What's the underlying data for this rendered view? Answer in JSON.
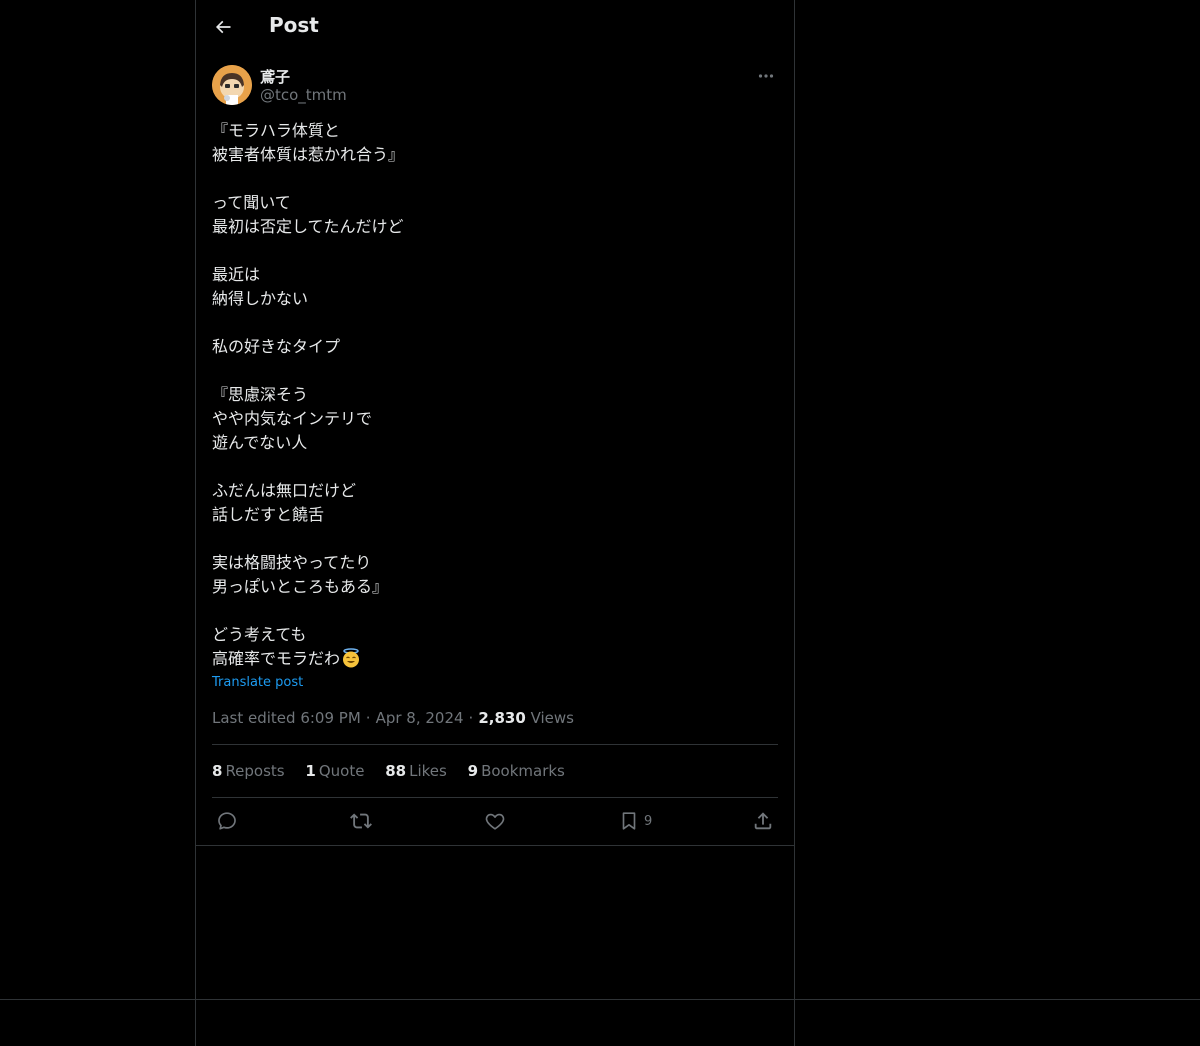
{
  "header": {
    "title": "Post"
  },
  "author": {
    "name": "鳶子",
    "handle": "@tco_tmtm"
  },
  "post": {
    "lines": [
      "『モラハラ体質と",
      "被害者体質は惹かれ合う』",
      "",
      "って聞いて",
      "最初は否定してたんだけど",
      "",
      "最近は",
      "納得しかない",
      "",
      "私の好きなタイプ",
      "",
      "『思慮深そう",
      "やや内気なインテリで",
      "遊んでない人",
      "",
      "ふだんは無口だけど",
      "話しだすと饒舌",
      "",
      "実は格闘技やってたり",
      "男っぽいところもある』",
      "",
      "どう考えても",
      "高確率でモラだわ"
    ],
    "emoji": "smiling-face-with-halo",
    "translate_label": "Translate post"
  },
  "meta": {
    "edited_label": "Last edited 6:09 PM",
    "date": "Apr 8, 2024",
    "separator": "·",
    "views_count": "2,830",
    "views_label": "Views"
  },
  "stats": {
    "reposts": {
      "count": "8",
      "label": "Reposts"
    },
    "quotes": {
      "count": "1",
      "label": "Quote"
    },
    "likes": {
      "count": "88",
      "label": "Likes"
    },
    "bookmarks": {
      "count": "9",
      "label": "Bookmarks"
    }
  },
  "actions": {
    "bookmark_count": "9"
  },
  "colors": {
    "background": "#000000",
    "text": "#e7e9ea",
    "secondary": "#71767b",
    "border": "#2f3336",
    "link": "#1d9bf0",
    "avatar_bg": "#e8a24a"
  },
  "icons": [
    "back-arrow-icon",
    "more-icon",
    "reply-icon",
    "repost-icon",
    "like-icon",
    "bookmark-icon",
    "share-icon"
  ]
}
